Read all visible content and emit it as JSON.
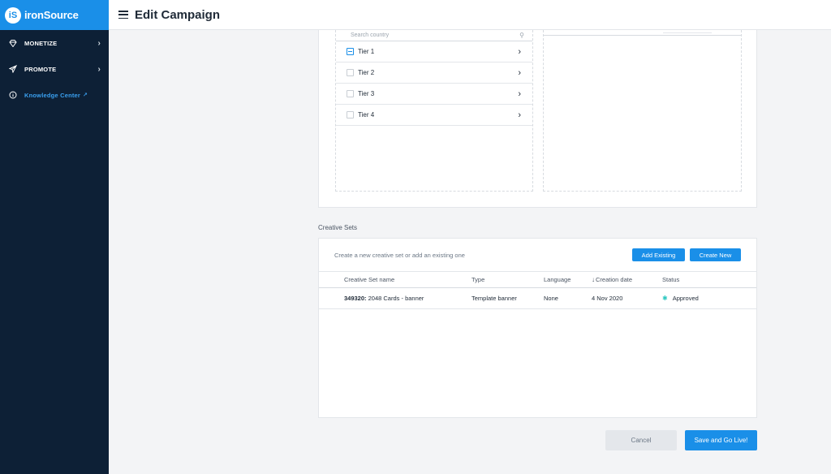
{
  "brand": {
    "logo": "iS",
    "name": "ironSource"
  },
  "sidebar": {
    "items": [
      {
        "label": "MONETIZE",
        "icon": "diamond-icon"
      },
      {
        "label": "PROMOTE",
        "icon": "paper-plane-icon"
      },
      {
        "label": "Knowledge Center",
        "icon": "info-icon"
      }
    ]
  },
  "header": {
    "title": "Edit Campaign"
  },
  "countries": {
    "search_placeholder": "Search country",
    "tiers": [
      {
        "label": "Tier 1",
        "state": "partial"
      },
      {
        "label": "Tier 2",
        "state": "unchecked"
      },
      {
        "label": "Tier 3",
        "state": "unchecked"
      },
      {
        "label": "Tier 4",
        "state": "unchecked"
      }
    ]
  },
  "creative_sets": {
    "section_title": "Creative Sets",
    "hint": "Create a new creative set or add an existing one",
    "add_existing_label": "Add Existing",
    "create_new_label": "Create New",
    "columns": [
      "Creative Set name",
      "Type",
      "Language",
      "Creation date",
      "Status"
    ],
    "rows": [
      {
        "id": "349320:",
        "name": "2048 Cards - banner",
        "type": "Template banner",
        "language": "None",
        "created": "4 Nov 2020",
        "status": "Approved"
      }
    ]
  },
  "footer": {
    "cancel_label": "Cancel",
    "save_label": "Save and Go Live!"
  },
  "colors": {
    "accent": "#1a8fe8",
    "sidebar": "#0d2036",
    "status_approved": "#2cc7c0"
  }
}
